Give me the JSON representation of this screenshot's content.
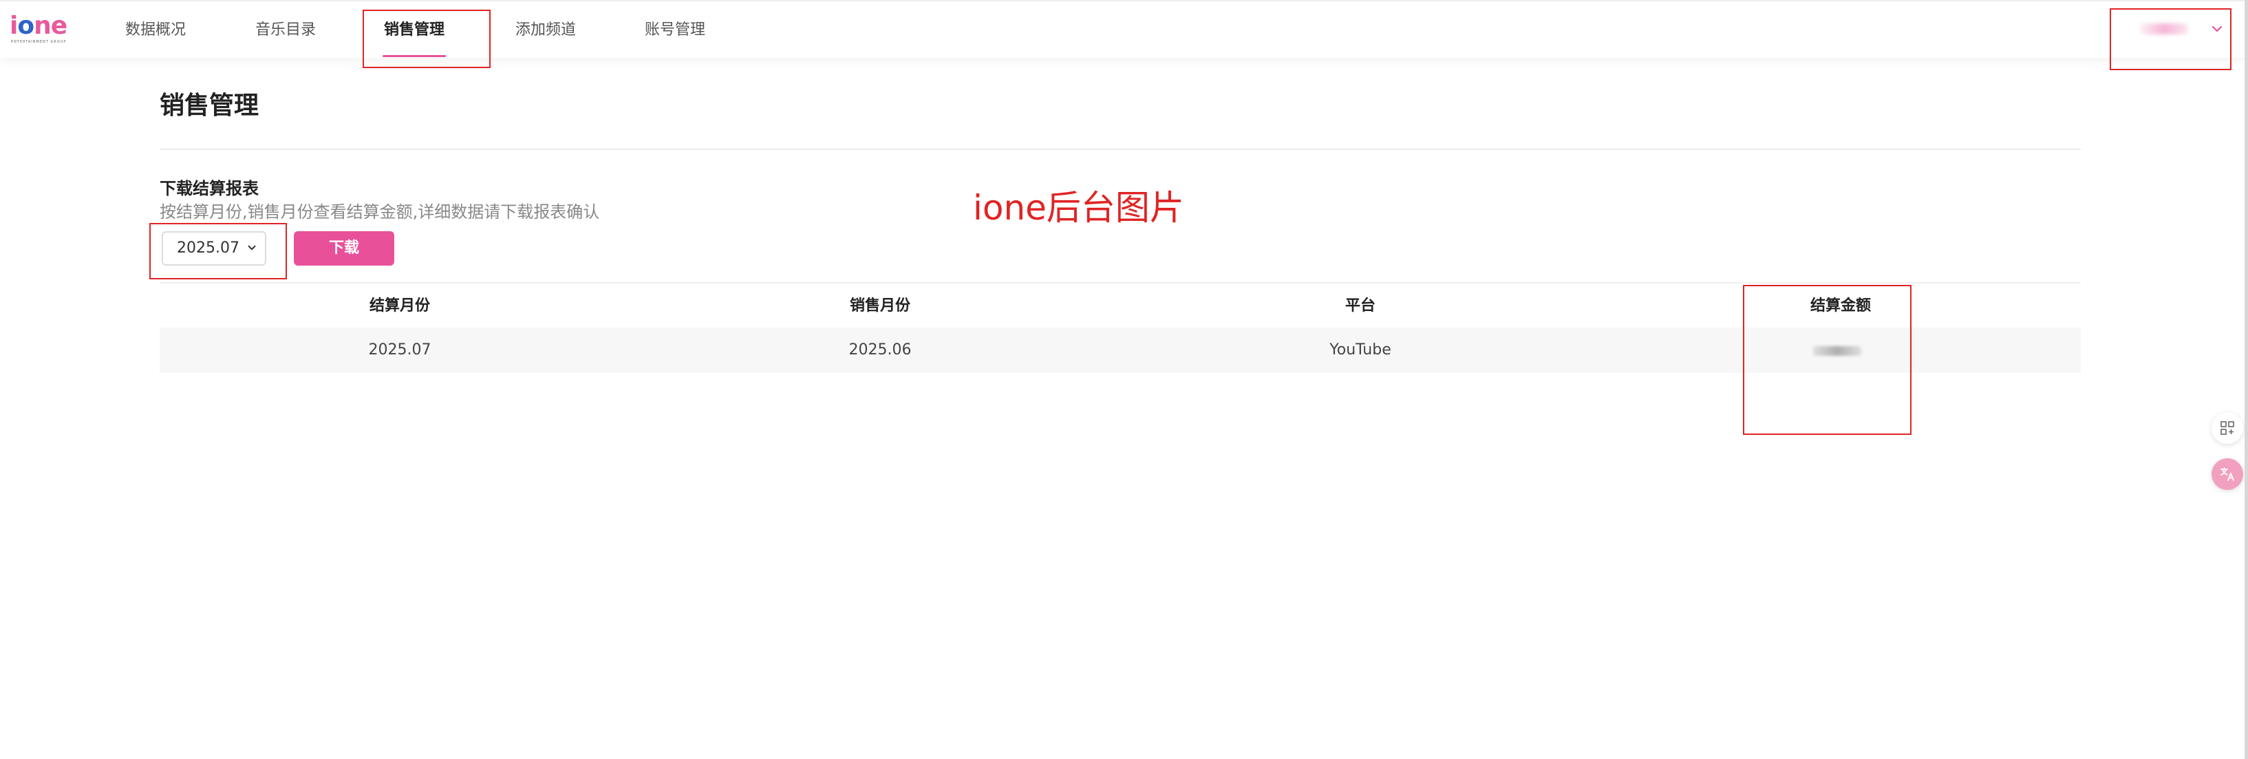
{
  "brand": {
    "logo_text_start": "i",
    "logo_text_o": "o",
    "logo_text_end": "ne",
    "logo_subtitle": "ENTERTAINMENT GROUP",
    "accent_color": "#e8519a"
  },
  "nav": {
    "items": [
      {
        "label": "数据概况"
      },
      {
        "label": "音乐目录"
      },
      {
        "label": "销售管理",
        "active": true
      },
      {
        "label": "添加频道"
      },
      {
        "label": "账号管理"
      }
    ]
  },
  "annotation": {
    "text": "ione后台图片",
    "color": "#e02424"
  },
  "page": {
    "title": "销售管理",
    "section_title": "下载结算报表",
    "section_desc": "按结算月份,销售月份查看结算金额,详细数据请下载报表确认"
  },
  "controls": {
    "month_selected": "2025.07",
    "download_label": "下载"
  },
  "table": {
    "headers": [
      "结算月份",
      "销售月份",
      "平台",
      "结算金额"
    ],
    "rows": [
      [
        "2025.07",
        "2025.06",
        "YouTube",
        ""
      ]
    ]
  },
  "icons": {
    "user_caret": "chevron-down-icon",
    "select_caret": "chevron-down-icon",
    "float_1": "grid-plus-icon",
    "float_2": "translate-icon"
  }
}
